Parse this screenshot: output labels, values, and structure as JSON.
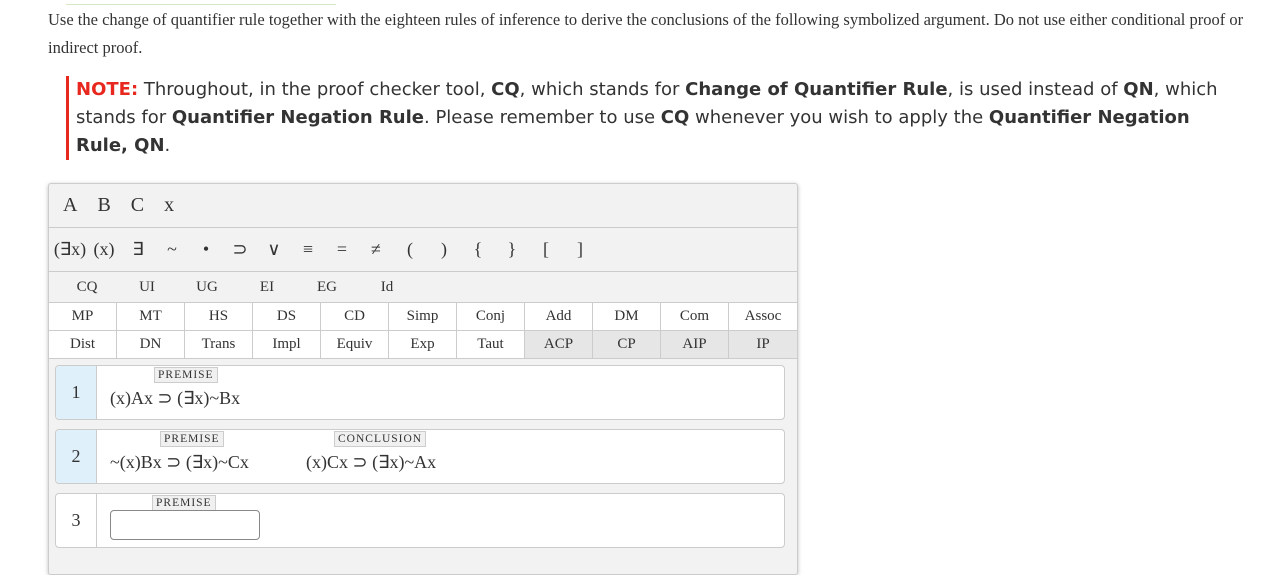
{
  "intro": "Use the change of quantifier rule together with the eighteen rules of inference to derive the conclusions of the following symbolized argument. Do not use either conditional proof or indirect proof.",
  "note": {
    "label": "NOTE:",
    "t1": " Throughout, in the proof checker tool, ",
    "b1": "CQ",
    "t2": ", which stands for ",
    "b2": "Change of Quantifier Rule",
    "t3": ", is used instead of ",
    "b3": "QN",
    "t4": ", which stands for ",
    "b4": "Quantifier Negation Rule",
    "t5": ". Please remember to use ",
    "b5": "CQ",
    "t6": " whenever you wish to apply the ",
    "b6": "Quantifier Negation Rule, QN",
    "t7": "."
  },
  "letters": [
    "A",
    "B",
    "C",
    "x"
  ],
  "symbols": [
    "(∃x)",
    "(x)",
    "∃",
    "~",
    "•",
    "⊃",
    "∨",
    "≡",
    "=",
    "≠",
    "(",
    ")",
    "{",
    "}",
    "[",
    "]"
  ],
  "quantifier_rules": [
    "CQ",
    "UI",
    "UG",
    "EI",
    "EG",
    "Id"
  ],
  "rules_row1": [
    "MP",
    "MT",
    "HS",
    "DS",
    "CD",
    "Simp",
    "Conj",
    "Add",
    "DM",
    "Com",
    "Assoc"
  ],
  "rules_row2": [
    "Dist",
    "DN",
    "Trans",
    "Impl",
    "Equiv",
    "Exp",
    "Taut",
    "ACP",
    "CP",
    "AIP",
    "IP"
  ],
  "lines": [
    {
      "num": "1",
      "tag": "PREMISE",
      "formula": "(x)Ax ⊃ (∃x)~Bx"
    },
    {
      "num": "2",
      "tag": "PREMISE",
      "formula": "~(x)Bx ⊃ (∃x)~Cx",
      "conclusion_tag": "CONCLUSION",
      "conclusion": "(x)Cx ⊃ (∃x)~Ax"
    },
    {
      "num": "3",
      "tag": "PREMISE",
      "value": ""
    }
  ],
  "colors": {
    "note_red": "#e8281e",
    "line_num_bg": "#dff0fb"
  }
}
